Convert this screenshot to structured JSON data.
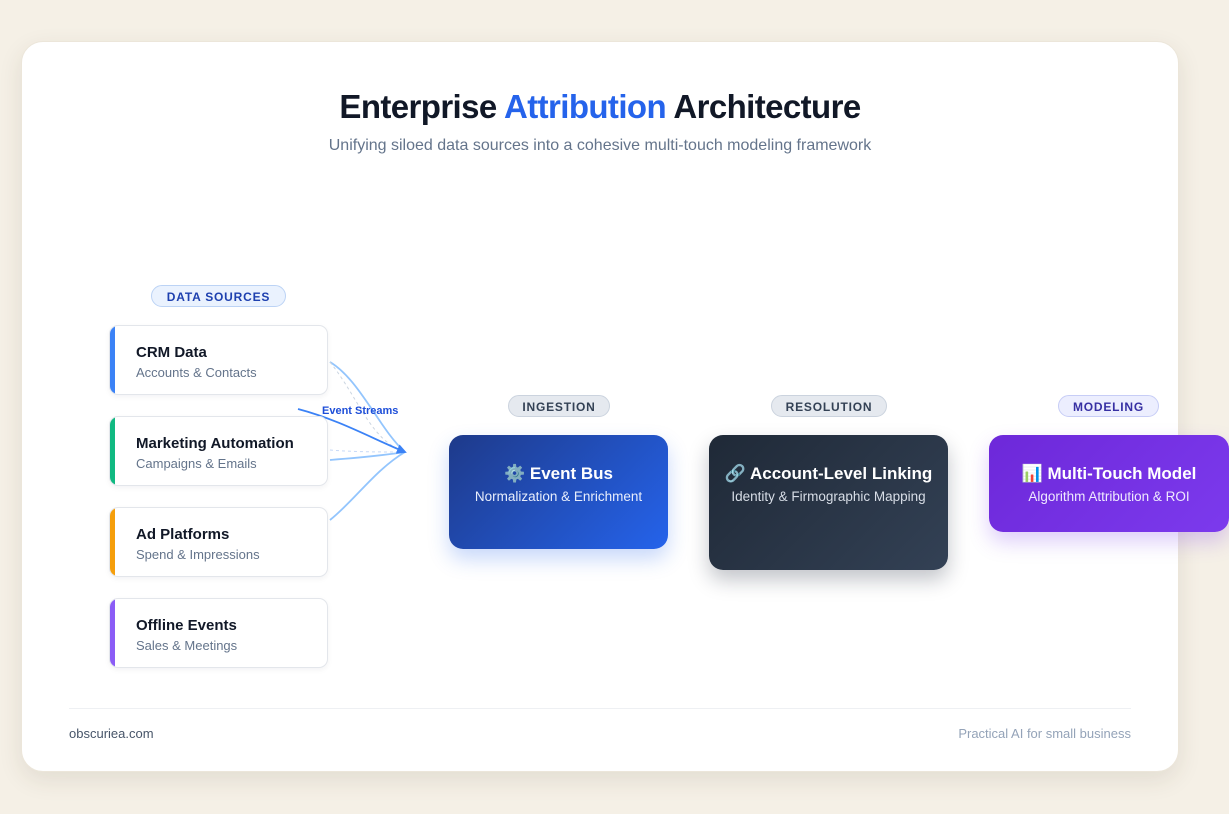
{
  "header": {
    "title_before": "Enterprise",
    "title_accent": "Attribution",
    "title_after": "Architecture",
    "subtitle": "Unifying siloed data sources into a cohesive multi-touch modeling framework"
  },
  "stages": {
    "sources": "DATA SOURCES",
    "ingestion": "INGESTION",
    "resolution": "RESOLUTION",
    "modeling": "MODELING"
  },
  "sources": [
    {
      "name": "CRM Data",
      "desc": "Accounts & Contacts",
      "color": "#3b82f6"
    },
    {
      "name": "Marketing Automation",
      "desc": "Campaigns & Emails",
      "color": "#10b981"
    },
    {
      "name": "Ad Platforms",
      "desc": "Spend & Impressions",
      "color": "#f59e0b"
    },
    {
      "name": "Offline Events",
      "desc": "Sales & Meetings",
      "color": "#8b5cf6"
    }
  ],
  "connector_label": "Event Streams",
  "nodes": {
    "event_bus": {
      "icon": "gear-icon",
      "title": "⚙️ Event Bus",
      "desc": "Normalization & Enrichment"
    },
    "account_linking": {
      "icon": "link-icon",
      "title": "🔗 Account-Level Linking",
      "desc": "Identity & Firmographic Mapping"
    },
    "multi_touch": {
      "icon": "bar-chart-icon",
      "title": "📊 Multi-Touch Model",
      "desc": "Algorithm Attribution & ROI"
    }
  },
  "footer": {
    "left": "obscuriea.com",
    "right": "Practical AI for small business"
  },
  "colors": {
    "accent": "#2563eb",
    "event_bus": "#1e40af",
    "account_linking": "#1f2937",
    "multi_touch": "#7c3aed"
  }
}
